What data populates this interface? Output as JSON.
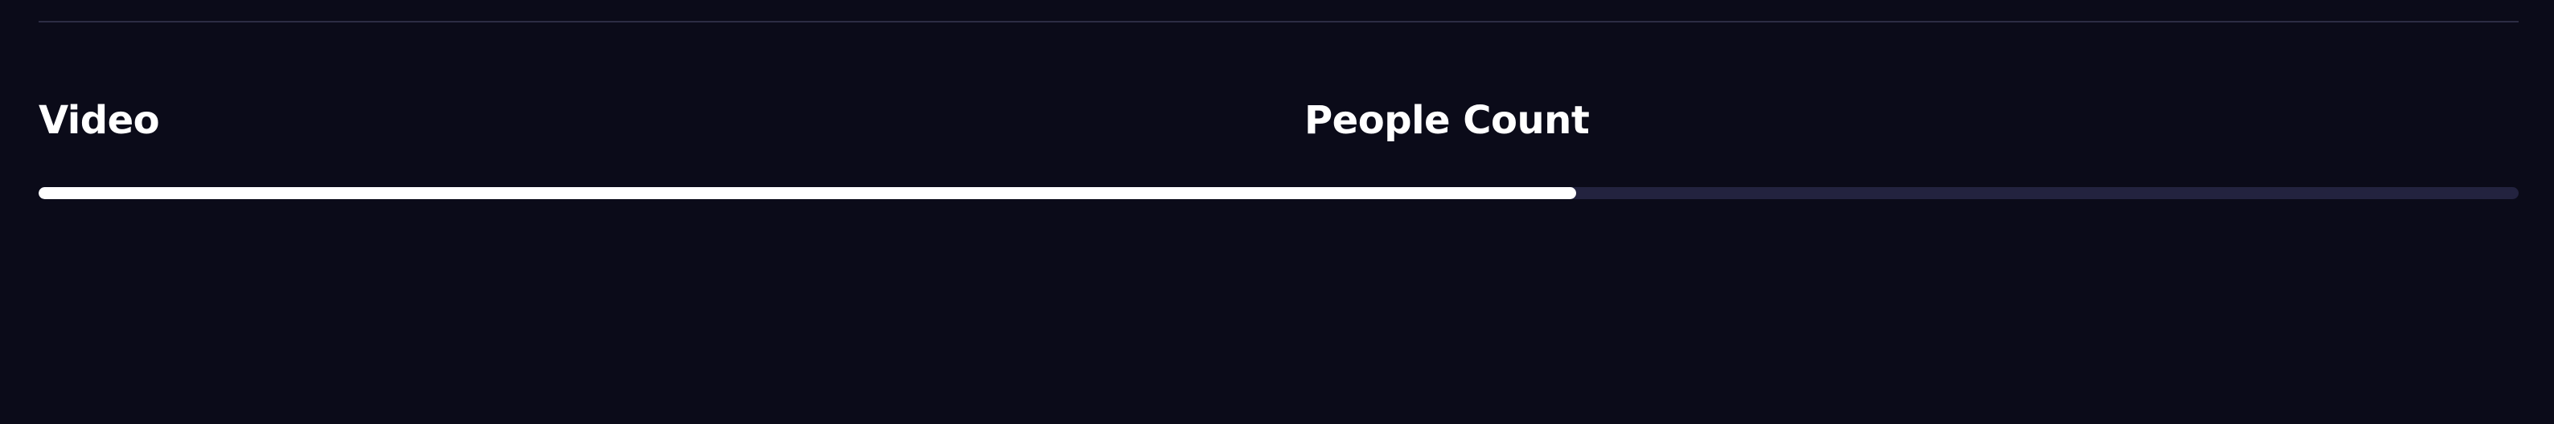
{
  "panels": {
    "video_label": "Video",
    "people_count_label": "People Count"
  },
  "progress": {
    "fraction": 0.62
  },
  "colors": {
    "background": "#0b0b19",
    "track": "#23233f",
    "fill": "#ffffff",
    "text": "#ffffff"
  }
}
